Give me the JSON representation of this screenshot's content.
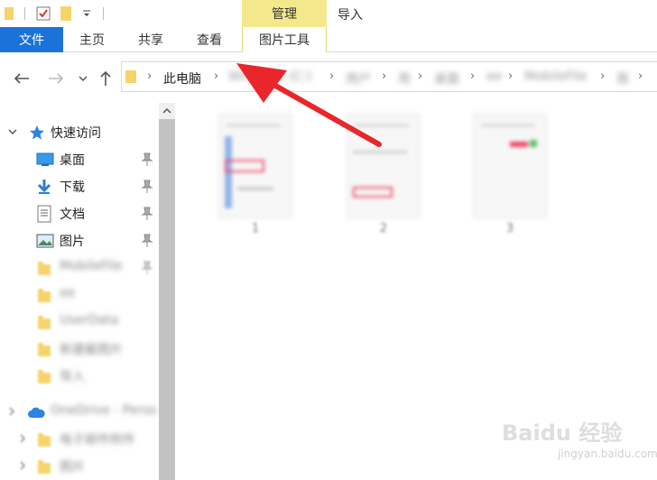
{
  "quick_access_toolbar": {
    "icons": [
      "folder-icon",
      "properties-checkbox-icon",
      "new-folder-icon",
      "customize-dropdown-icon"
    ]
  },
  "ribbon": {
    "context_group_label": "管理",
    "import_label": "导入",
    "tabs": [
      {
        "label": "文件"
      },
      {
        "label": "主页"
      },
      {
        "label": "共享"
      },
      {
        "label": "查看"
      },
      {
        "label": "图片工具"
      }
    ]
  },
  "address": {
    "crumbs": [
      "此电脑",
      "Windows (C:)",
      "用户",
      "用",
      "桌面",
      "ee",
      "MobileFile",
      "我"
    ]
  },
  "navigation": {
    "quick_access_label": "快速访问",
    "pinned": [
      {
        "label": "桌面",
        "icon": "desktop-icon"
      },
      {
        "label": "下载",
        "icon": "download-icon"
      },
      {
        "label": "文档",
        "icon": "document-icon"
      },
      {
        "label": "图片",
        "icon": "picture-icon"
      },
      {
        "label": "MobileFile",
        "icon": "folder-icon"
      },
      {
        "label": "ee",
        "icon": "folder-icon"
      },
      {
        "label": "UserData",
        "icon": "folder-icon"
      },
      {
        "label": "新建截图片",
        "icon": "folder-icon"
      },
      {
        "label": "导入",
        "icon": "folder-icon"
      }
    ],
    "onedrive_label": "OneDrive - Perso",
    "onedrive_children": [
      {
        "label": "电子邮件附件"
      },
      {
        "label": "图片"
      }
    ]
  },
  "files": [
    {
      "name": "1"
    },
    {
      "name": "2"
    },
    {
      "name": "3"
    }
  ],
  "watermark": {
    "main": "Baidu 经验",
    "sub": "jingyan.baidu.com"
  },
  "colors": {
    "file_tab": "#1a73d9",
    "context_tab": "#f3e98c",
    "arrow": "#e8262b",
    "folder": "#f6d46b"
  }
}
